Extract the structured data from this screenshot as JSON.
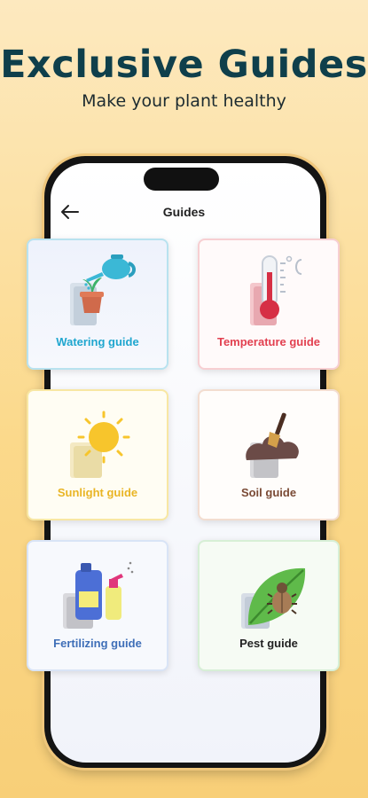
{
  "promo": {
    "headline": "Exclusive Guides",
    "subline": "Make your plant healthy"
  },
  "app": {
    "nav_title": "Guides",
    "back_icon": "back-arrow-icon"
  },
  "guides": [
    {
      "label": "Watering guide",
      "icon": "watering-can-icon",
      "color": "#1fa6cf"
    },
    {
      "label": "Temperature guide",
      "icon": "thermometer-icon",
      "color": "#e24050"
    },
    {
      "label": "Sunlight guide",
      "icon": "sun-icon",
      "color": "#e9b525"
    },
    {
      "label": "Soil guide",
      "icon": "soil-shovel-icon",
      "color": "#7a4a35"
    },
    {
      "label": "Fertilizing guide",
      "icon": "fertilizer-bottle-icon",
      "color": "#3f6fb8"
    },
    {
      "label": "Pest guide",
      "icon": "beetle-leaf-icon",
      "color": "#222222"
    }
  ],
  "colors": {
    "background": "#fbd98b",
    "headline": "#0f3f4b"
  }
}
